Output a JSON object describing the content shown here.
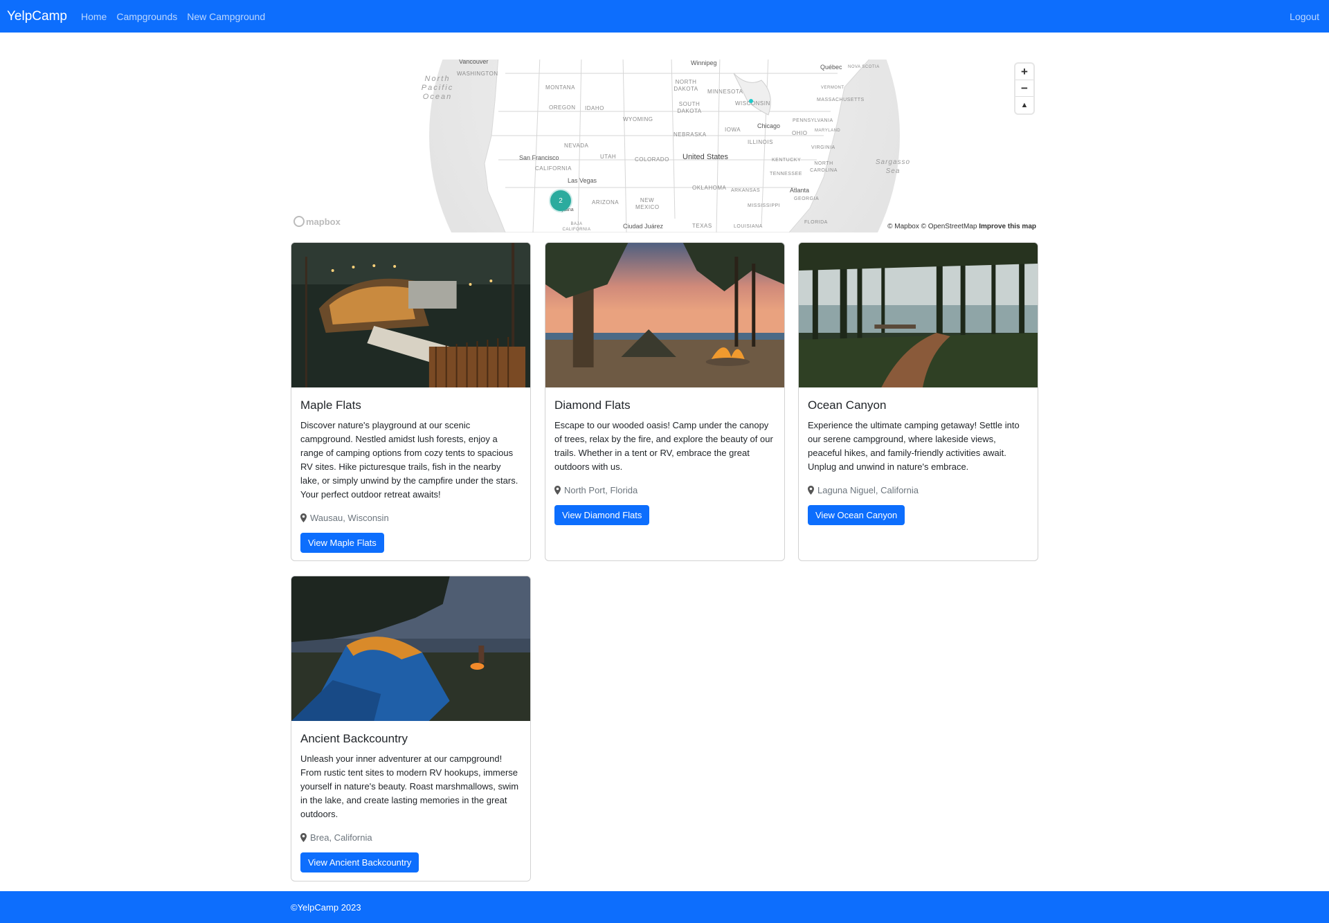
{
  "navbar": {
    "brand": "YelpCamp",
    "links": [
      "Home",
      "Campgrounds",
      "New Campground"
    ],
    "logout": "Logout",
    "background": "#0d6efd"
  },
  "map": {
    "labels": {
      "vancouver": "Vancouver",
      "winnipeg": "Winnipeg",
      "quebec": "Québec",
      "nova_scotia": "NOVA SCOTIA",
      "washington": "WASHINGTON",
      "montana": "MONTANA",
      "north_dakota": "NORTH DAKOTA",
      "minnesota": "MINNESOTA",
      "vermont": "VERMONT",
      "oregon": "OREGON",
      "idaho": "IDAHO",
      "south_dakota": "SOUTH DAKOTA",
      "wisconsin": "WISCONSIN",
      "massachusetts": "MASSACHUSETTS",
      "wyoming": "WYOMING",
      "pennsylvania": "PENNSYLVANIA",
      "chicago": "Chicago",
      "iowa": "IOWA",
      "maryland": "MARYLAND",
      "nevada": "NEVADA",
      "nebraska": "NEBRASKA",
      "ohio": "OHIO",
      "illinois": "ILLINOIS",
      "virginia": "VIRGINIA",
      "utah": "UTAH",
      "colorado": "COLORADO",
      "united_states": "United States",
      "kentucky": "KENTUCKY",
      "san_francisco": "San Francisco",
      "california": "CALIFORNIA",
      "north_carolina": "NORTH CAROLINA",
      "tennessee": "TENNESSEE",
      "las_vegas": "Las Vegas",
      "oklahoma": "OKLAHOMA",
      "arkansas": "ARKANSAS",
      "atlanta": "Atlanta",
      "georgia": "GEORGIA",
      "arizona": "ARIZONA",
      "new_mexico": "NEW MEXICO",
      "mississippi": "MISSISSIPPI",
      "tijuana": "Tijuana",
      "ciudad_juarez": "Ciudad Juárez",
      "texas": "TEXAS",
      "louisiana": "LOUISIANA",
      "florida": "FLORIDA",
      "baja_california": "BAJA CALIFORNIA",
      "north_pacific_ocean": "North Pacific Ocean",
      "sargasso_sea": "Sargasso Sea"
    },
    "cluster_count": "2",
    "controls": {
      "zoom_in": "+",
      "zoom_out": "−",
      "compass": "▲"
    },
    "logo_text": "mapbox",
    "attribution": {
      "mapbox": "© Mapbox",
      "osm": "© OpenStreetMap",
      "improve": "Improve this map"
    },
    "cluster_color": "#2bab9e"
  },
  "campgrounds": [
    {
      "title": "Maple Flats",
      "description": "Discover nature's playground at our scenic campground. Nestled amidst lush forests, enjoy a range of camping options from cozy tents to spacious RV sites. Hike picturesque trails, fish in the nearby lake, or simply unwind by the campfire under the stars. Your perfect outdoor retreat awaits!",
      "location": "Wausau, Wisconsin",
      "button": "View Maple Flats"
    },
    {
      "title": "Diamond Flats",
      "description": "Escape to our wooded oasis! Camp under the canopy of trees, relax by the fire, and explore the beauty of our trails. Whether in a tent or RV, embrace the great outdoors with us.",
      "location": "North Port, Florida",
      "button": "View Diamond Flats"
    },
    {
      "title": "Ocean Canyon",
      "description": "Experience the ultimate camping getaway! Settle into our serene campground, where lakeside views, peaceful hikes, and family-friendly activities await. Unplug and unwind in nature's embrace.",
      "location": "Laguna Niguel, California",
      "button": "View Ocean Canyon"
    },
    {
      "title": "Ancient Backcountry",
      "description": "Unleash your inner adventurer at our campground! From rustic tent sites to modern RV hookups, immerse yourself in nature's beauty. Roast marshmallows, swim in the lake, and create lasting memories in the great outdoors.",
      "location": "Brea, California",
      "button": "View Ancient Backcountry"
    }
  ],
  "footer": {
    "text": "©YelpCamp 2023"
  }
}
